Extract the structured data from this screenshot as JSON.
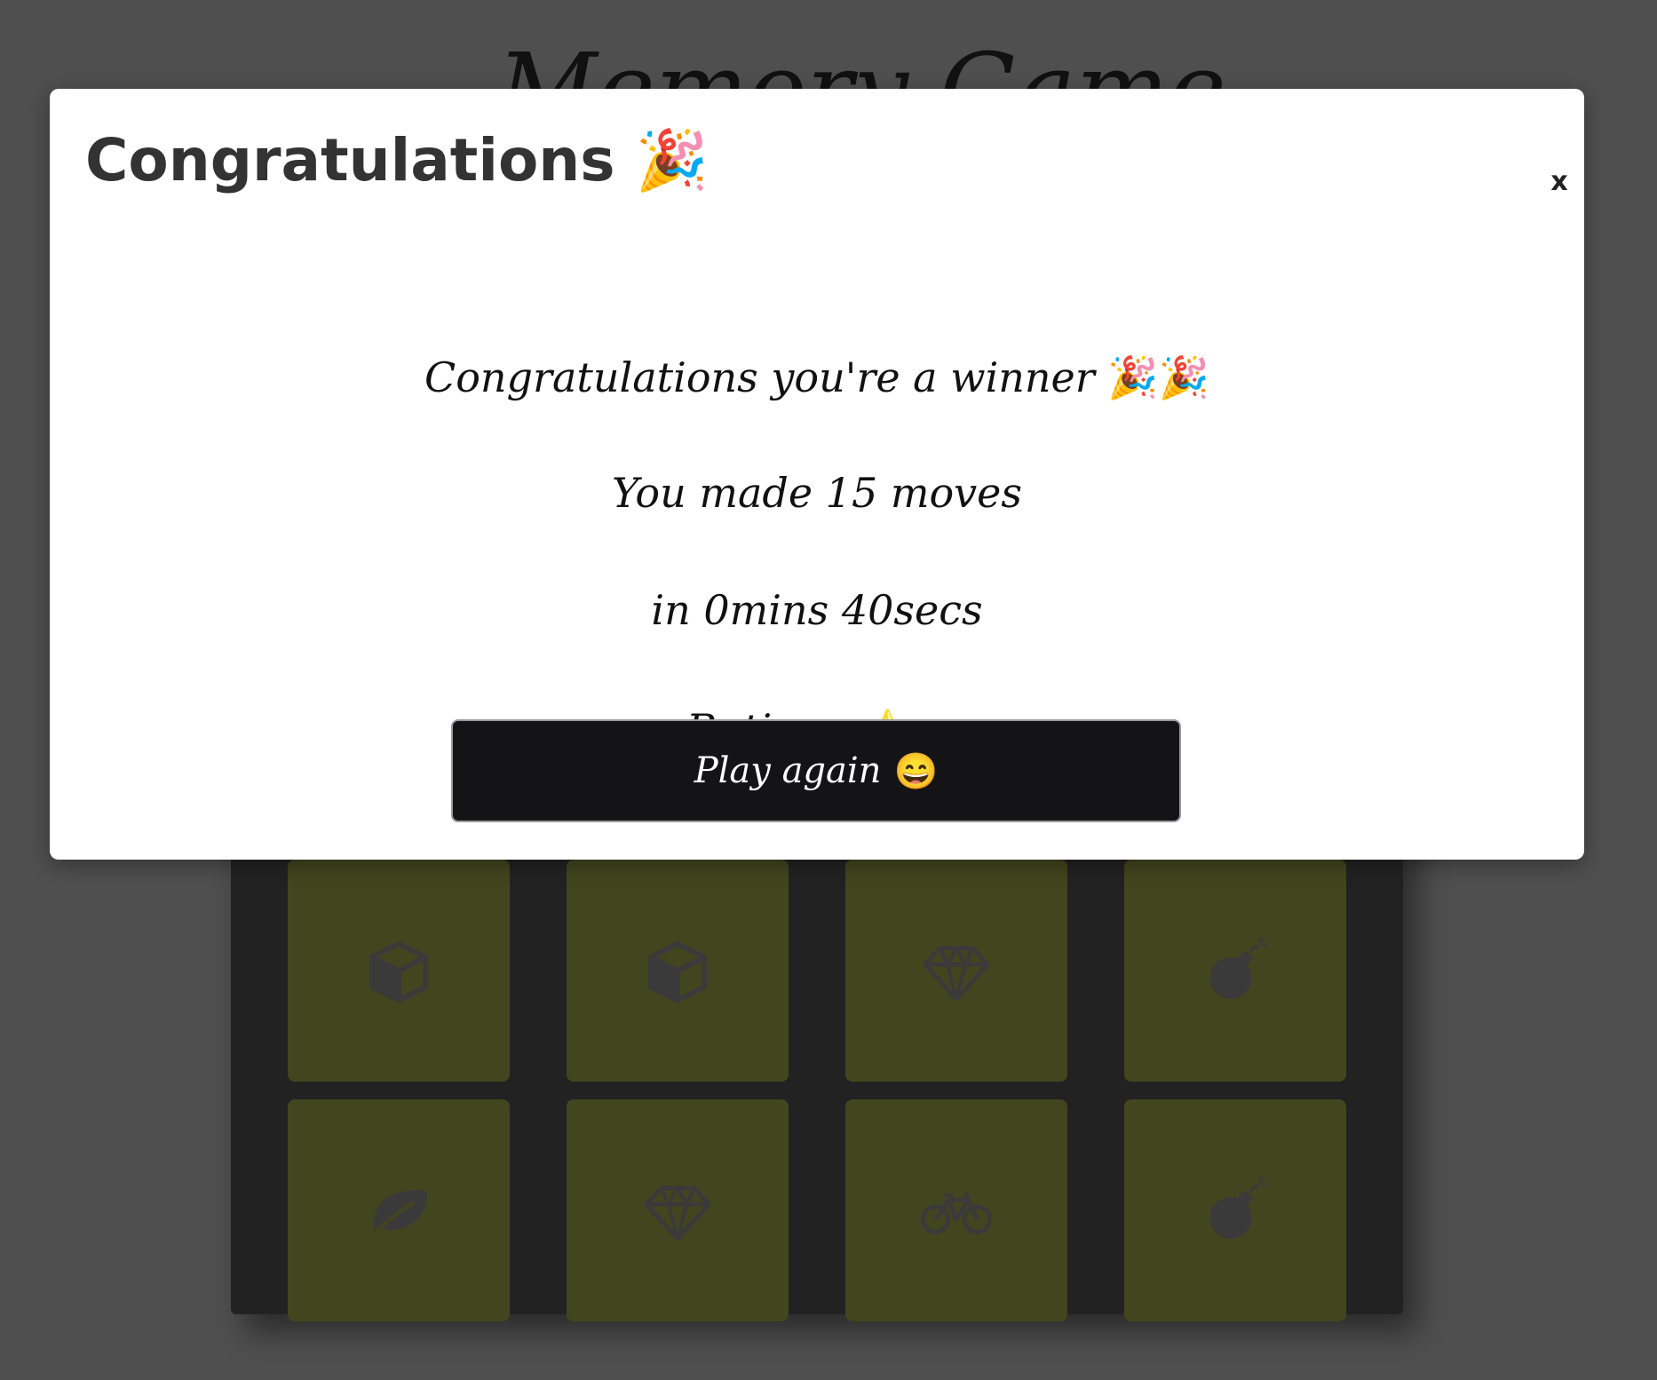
{
  "game": {
    "title": "Memory Game"
  },
  "modal": {
    "title": "Congratulations",
    "title_emoji": "🎉",
    "close_label": "x",
    "message": "Congratulations you're a winner",
    "message_emoji": "🎉🎉",
    "moves_text": "You made 15 moves",
    "time_text": "in 0mins 40secs",
    "rating_label": "Rating:",
    "rating_stars": "⭐",
    "play_again_label": "Play again",
    "play_again_emoji": "😄"
  },
  "deck": {
    "cards": [
      {
        "icon": "cube-icon"
      },
      {
        "icon": "cube-icon"
      },
      {
        "icon": "diamond-icon"
      },
      {
        "icon": "bomb-icon"
      },
      {
        "icon": "leaf-icon"
      },
      {
        "icon": "diamond-icon"
      },
      {
        "icon": "bicycle-icon"
      },
      {
        "icon": "bomb-icon"
      }
    ],
    "card_color": "#42461e",
    "icon_color": "#3a3a3a"
  },
  "colors": {
    "background": "#4f4f4f",
    "deck": "#222222",
    "button": "#141316",
    "star": "#f5c518"
  }
}
